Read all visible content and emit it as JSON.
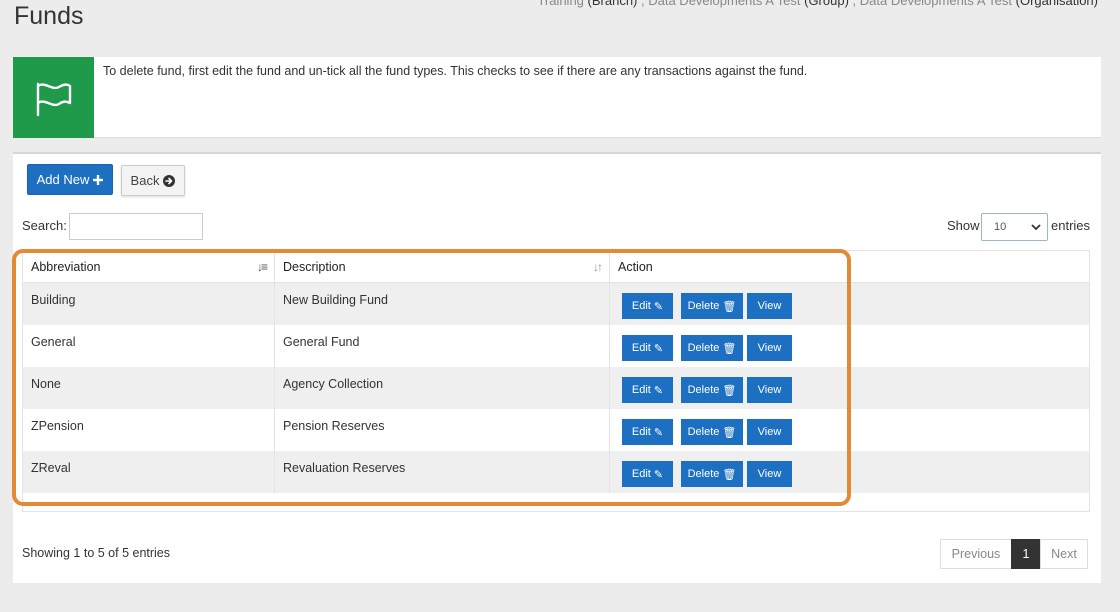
{
  "page": {
    "title": "Funds",
    "context": {
      "branch": "Training",
      "branch_suffix": "(Branch)",
      "group": "Data Developments A Test",
      "group_suffix": "(Group)",
      "org": "Data Developments A Test",
      "org_suffix": "(Organisation)"
    }
  },
  "info": {
    "icon": "flag-icon",
    "text": "To delete fund, first edit the fund and un-tick all the fund types. This checks to see if there are any transactions against the fund."
  },
  "toolbar": {
    "add_label": "Add New",
    "add_icon": "plus-icon",
    "back_label": "Back",
    "back_icon": "arrow-circle-right-icon"
  },
  "controls": {
    "search_label": "Search:",
    "search_value": "",
    "show_label": "Show",
    "page_size": "10",
    "entries_label": "entries"
  },
  "table": {
    "headers": [
      "Abbreviation",
      "Description",
      "Action"
    ],
    "rows": [
      {
        "abbreviation": "Building",
        "description": "New Building Fund"
      },
      {
        "abbreviation": "General",
        "description": "General Fund"
      },
      {
        "abbreviation": "None",
        "description": "Agency Collection"
      },
      {
        "abbreviation": "ZPension",
        "description": "Pension Reserves"
      },
      {
        "abbreviation": "ZReval",
        "description": "Revaluation Reserves"
      }
    ],
    "action_labels": {
      "edit": "Edit",
      "delete": "Delete",
      "view": "View"
    }
  },
  "footer": {
    "info": "Showing 1 to 5 of 5 entries",
    "prev": "Previous",
    "current_page": "1",
    "next": "Next"
  },
  "colors": {
    "primary": "#1d6fc2",
    "info_icon_bg": "#1f9a4a",
    "highlight": "#e38a36"
  }
}
